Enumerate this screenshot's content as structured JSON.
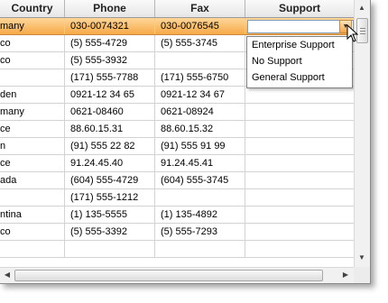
{
  "grid": {
    "columns": [
      "Country",
      "Phone",
      "Fax",
      "Support"
    ],
    "rows": [
      {
        "country": "many",
        "phone": "030-0074321",
        "fax": "030-0076545",
        "support": ""
      },
      {
        "country": "co",
        "phone": "(5) 555-4729",
        "fax": "(5) 555-3745",
        "support": ""
      },
      {
        "country": "co",
        "phone": "(5) 555-3932",
        "fax": "",
        "support": ""
      },
      {
        "country": "",
        "phone": "(171) 555-7788",
        "fax": "(171) 555-6750",
        "support": ""
      },
      {
        "country": "den",
        "phone": "0921-12 34 65",
        "fax": "0921-12 34 67",
        "support": ""
      },
      {
        "country": "many",
        "phone": "0621-08460",
        "fax": "0621-08924",
        "support": ""
      },
      {
        "country": "ce",
        "phone": "88.60.15.31",
        "fax": "88.60.15.32",
        "support": ""
      },
      {
        "country": "n",
        "phone": "(91) 555 22 82",
        "fax": "(91) 555 91 99",
        "support": ""
      },
      {
        "country": "ce",
        "phone": "91.24.45.40",
        "fax": "91.24.45.41",
        "support": ""
      },
      {
        "country": "ada",
        "phone": "(604) 555-4729",
        "fax": "(604) 555-3745",
        "support": ""
      },
      {
        "country": "",
        "phone": "(171) 555-1212",
        "fax": "",
        "support": ""
      },
      {
        "country": "ntina",
        "phone": "(1) 135-5555",
        "fax": "(1) 135-4892",
        "support": ""
      },
      {
        "country": "co",
        "phone": "(5) 555-3392",
        "fax": "(5) 555-7293",
        "support": ""
      },
      {
        "country": "",
        "phone": "",
        "fax": "",
        "support": ""
      }
    ],
    "selected_row": 0
  },
  "support_dropdown": {
    "current_value": "",
    "options": [
      "Enterprise Support",
      "No Support",
      "General Support"
    ]
  },
  "icons": {
    "dropdown_arrow": "chevron-down-icon",
    "scroll_up": "arrow-up-icon",
    "scroll_down": "arrow-down-icon",
    "scroll_left": "arrow-left-icon",
    "scroll_right": "arrow-right-icon",
    "cursor": "mouse-pointer-icon"
  },
  "colors": {
    "selected_row_top": "#fdd79a",
    "selected_row_bottom": "#f6a948",
    "grid_line": "#d2d2d2",
    "header_bg": "#e6e6e6"
  }
}
